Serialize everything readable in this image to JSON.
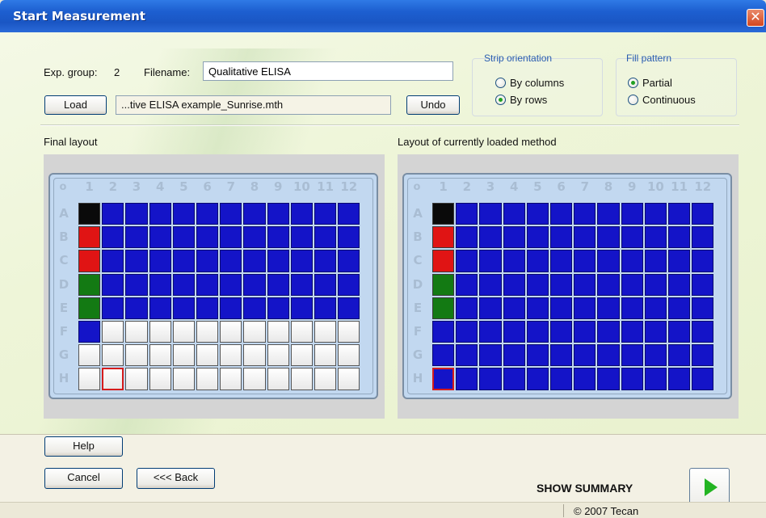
{
  "window": {
    "title": "Start Measurement"
  },
  "header": {
    "exp_group_label": "Exp. group:",
    "exp_group_value": "2",
    "filename_label": "Filename:",
    "filename_value": "Qualitative ELISA",
    "load_label": "Load",
    "method_path": "...tive ELISA example_Sunrise.mth",
    "undo_label": "Undo"
  },
  "strip_orientation": {
    "title": "Strip orientation",
    "options": [
      "By columns",
      "By rows"
    ],
    "selected": "By rows"
  },
  "fill_pattern": {
    "title": "Fill pattern",
    "options": [
      "Partial",
      "Continuous"
    ],
    "selected": "Partial"
  },
  "plates": {
    "final_title": "Final layout",
    "loaded_title": "Layout of currently loaded method",
    "corner": "o",
    "columns": [
      "1",
      "2",
      "3",
      "4",
      "5",
      "6",
      "7",
      "8",
      "9",
      "10",
      "11",
      "12"
    ],
    "rows": [
      "A",
      "B",
      "C",
      "D",
      "E",
      "F",
      "G",
      "H"
    ],
    "well_colors": {
      "sample": "#1414c8",
      "blank": "#0a0a0a",
      "negative_control": "#e01414",
      "positive_control": "#137a13",
      "empty": "#ffffff",
      "selection": "#d51c1c"
    }
  },
  "buttons": {
    "help": "Help",
    "cancel": "Cancel",
    "back": "<<< Back"
  },
  "summary": {
    "label": "SHOW SUMMARY"
  },
  "status": {
    "copyright": "© 2007 Tecan"
  }
}
